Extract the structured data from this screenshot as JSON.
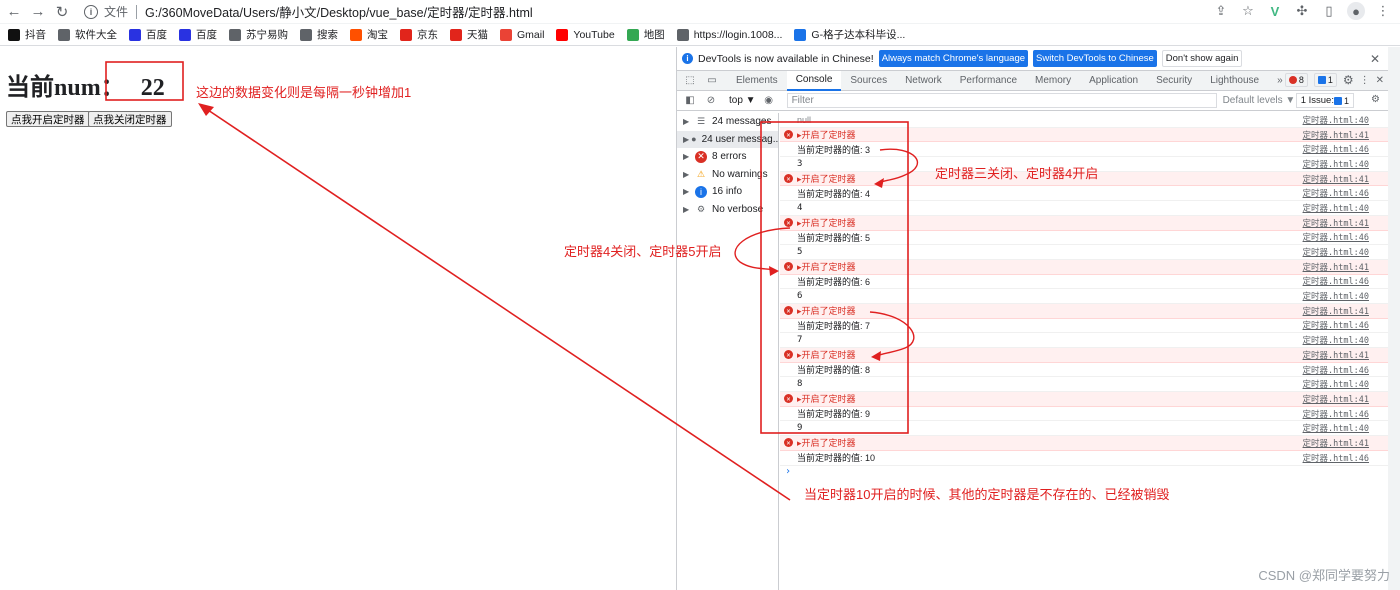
{
  "browser": {
    "scheme_label": "文件",
    "url": "G:/360MoveData/Users/静小文/Desktop/vue_base/定时器/定时器.html",
    "bookmarks": [
      {
        "label": "抖音",
        "color": "#111111"
      },
      {
        "label": "软件大全",
        "color": "#5f6368"
      },
      {
        "label": "百度",
        "color": "#2932e1"
      },
      {
        "label": "百度",
        "color": "#2932e1"
      },
      {
        "label": "苏宁易购",
        "color": "#5f6368"
      },
      {
        "label": "搜索",
        "color": "#5f6368"
      },
      {
        "label": "淘宝",
        "color": "#ff5000"
      },
      {
        "label": "京东",
        "color": "#e1251b"
      },
      {
        "label": "天猫",
        "color": "#e1251b"
      },
      {
        "label": "Gmail",
        "color": "#ea4335"
      },
      {
        "label": "YouTube",
        "color": "#ff0000"
      },
      {
        "label": "地图",
        "color": "#34a853"
      },
      {
        "label": "https://login.1008...",
        "color": "#5f6368"
      },
      {
        "label": "G-格子达本科毕设...",
        "color": "#1a73e8"
      }
    ]
  },
  "page": {
    "heading_label": "当前num：",
    "num_value": "22",
    "start_button": "点我开启定时器",
    "stop_button": "点我关闭定时器"
  },
  "devtools": {
    "infobar": {
      "message": "DevTools is now available in Chinese!",
      "match_button": "Always match Chrome's language",
      "switch_button": "Switch DevTools to Chinese",
      "dismiss_button": "Don't show again"
    },
    "tabs": [
      "Elements",
      "Console",
      "Sources",
      "Network",
      "Performance",
      "Memory",
      "Application",
      "Security",
      "Lighthouse"
    ],
    "active_tab": "Console",
    "more_tabs": "»",
    "error_count": "8",
    "message_count": "1",
    "context": "top ▼",
    "filter_placeholder": "Filter",
    "levels": "Default levels ▼",
    "issues": "1 Issue: ",
    "issues_count": "1",
    "sidebar": [
      {
        "label": "24 messages",
        "icon": "☰",
        "selected": false
      },
      {
        "label": "24 user messag...",
        "icon": "●",
        "selected": true
      },
      {
        "label": "8 errors",
        "icon": "✕",
        "selected": false
      },
      {
        "label": "No warnings",
        "icon": "⚠",
        "selected": false
      },
      {
        "label": "16 info",
        "icon": "i",
        "selected": false
      },
      {
        "label": "No verbose",
        "icon": "⚙",
        "selected": false
      }
    ],
    "console_rows": [
      {
        "type": "null",
        "text": "null",
        "src": "定时器.html:40"
      },
      {
        "type": "err",
        "text": "▸开启了定时器",
        "src": "定时器.html:41"
      },
      {
        "type": "log",
        "text": "当前定时器的值: 3",
        "src": "定时器.html:46"
      },
      {
        "type": "log",
        "text": "3",
        "src": "定时器.html:40"
      },
      {
        "type": "err",
        "text": "▸开启了定时器",
        "src": "定时器.html:41"
      },
      {
        "type": "log",
        "text": "当前定时器的值: 4",
        "src": "定时器.html:46"
      },
      {
        "type": "log",
        "text": "4",
        "src": "定时器.html:40"
      },
      {
        "type": "err",
        "text": "▸开启了定时器",
        "src": "定时器.html:41"
      },
      {
        "type": "log",
        "text": "当前定时器的值: 5",
        "src": "定时器.html:46"
      },
      {
        "type": "log",
        "text": "5",
        "src": "定时器.html:40"
      },
      {
        "type": "err",
        "text": "▸开启了定时器",
        "src": "定时器.html:41"
      },
      {
        "type": "log",
        "text": "当前定时器的值: 6",
        "src": "定时器.html:46"
      },
      {
        "type": "log",
        "text": "6",
        "src": "定时器.html:40"
      },
      {
        "type": "err",
        "text": "▸开启了定时器",
        "src": "定时器.html:41"
      },
      {
        "type": "log",
        "text": "当前定时器的值: 7",
        "src": "定时器.html:46"
      },
      {
        "type": "log",
        "text": "7",
        "src": "定时器.html:40"
      },
      {
        "type": "err",
        "text": "▸开启了定时器",
        "src": "定时器.html:41"
      },
      {
        "type": "log",
        "text": "当前定时器的值: 8",
        "src": "定时器.html:46"
      },
      {
        "type": "log",
        "text": "8",
        "src": "定时器.html:40"
      },
      {
        "type": "err",
        "text": "▸开启了定时器",
        "src": "定时器.html:41"
      },
      {
        "type": "log",
        "text": "当前定时器的值: 9",
        "src": "定时器.html:46"
      },
      {
        "type": "log",
        "text": "9",
        "src": "定时器.html:40"
      },
      {
        "type": "err",
        "text": "▸开启了定时器",
        "src": "定时器.html:41"
      },
      {
        "type": "log",
        "text": "当前定时器的值: 10",
        "src": "定时器.html:46"
      }
    ],
    "prompt": "›"
  },
  "annotations": {
    "data_change": "这边的数据变化则是每隔一秒钟增加1",
    "timer3": "定时器三关闭、定时器4开启",
    "timer4": "定时器4关闭、定时器5开启",
    "timer10": "当定时器10开启的时候、其他的定时器是不存在的、已经被销毁",
    "color": "#e02020"
  },
  "watermark": "CSDN @郑同学要努力"
}
